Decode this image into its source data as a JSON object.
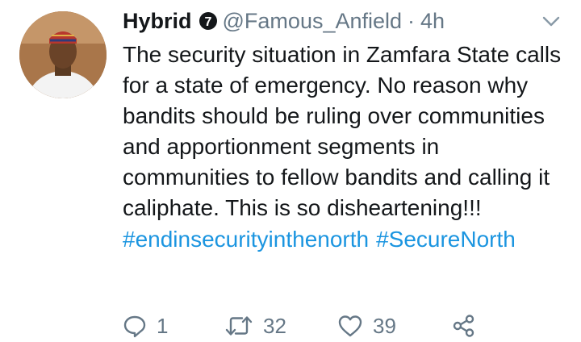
{
  "tweet": {
    "display_name": "Hybrid",
    "verified_badge": "7",
    "handle": "@Famous_Anfield",
    "separator": "·",
    "time": "4h",
    "text": "The security situation in Zamfara State calls for a state of emergency. No reason why bandits should be ruling over communities and apportionment segments in communities to fellow bandits and calling it caliphate. This is so disheartening!!!",
    "hashtags": [
      "#endinsecurityinthenorth",
      "#SecureNorth"
    ]
  },
  "actions": {
    "reply_count": "1",
    "retweet_count": "32",
    "like_count": "39"
  },
  "icons": {
    "avatar": "user-avatar",
    "badge": "number-badge-icon",
    "menu": "chevron-down-icon",
    "reply": "reply-icon",
    "retweet": "retweet-icon",
    "like": "heart-icon",
    "share": "share-icon"
  },
  "colors": {
    "text": "#14171a",
    "muted": "#657786",
    "link": "#1b95e0"
  }
}
